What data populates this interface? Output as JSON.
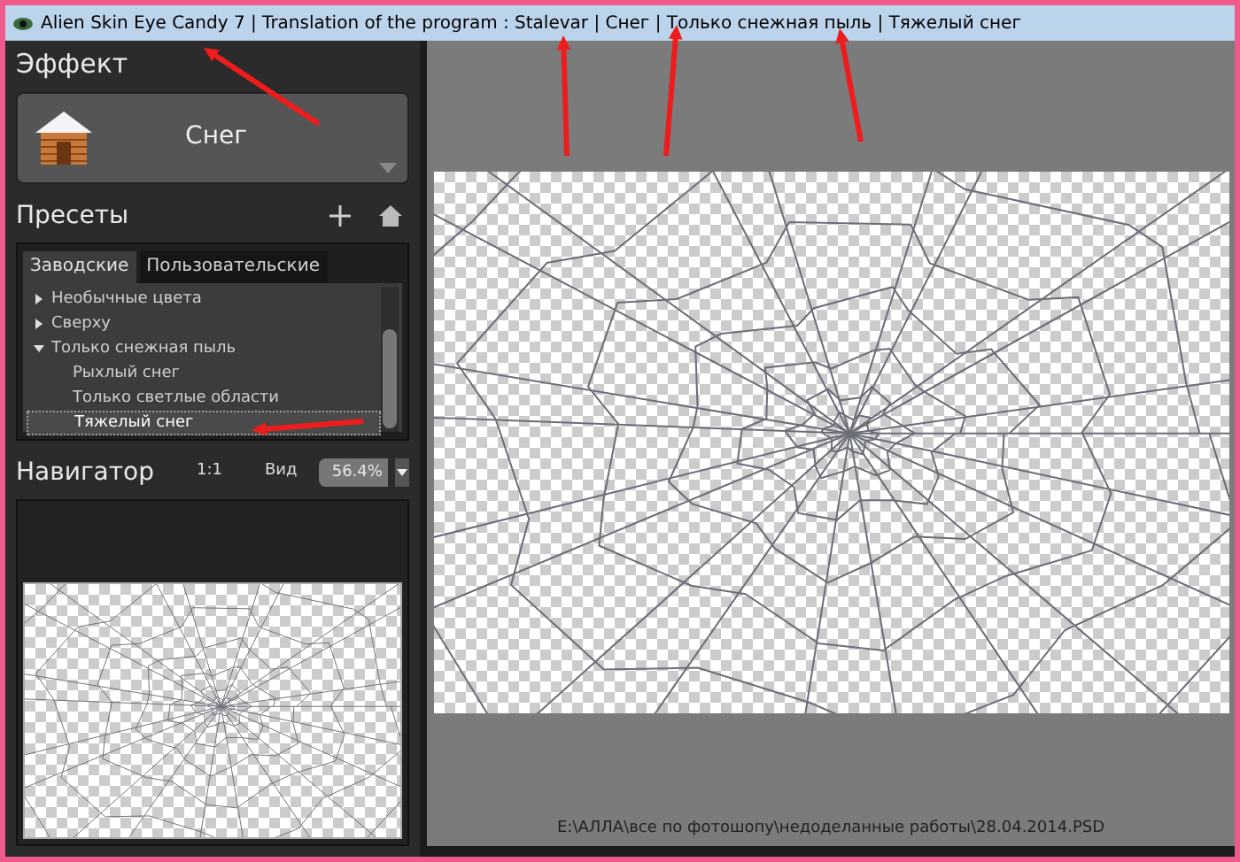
{
  "window": {
    "title": "Alien Skin Eye Candy 7 | Translation of the program : Stalevar | Снег | Только снежная пыль | Тяжелый снег"
  },
  "effect": {
    "heading": "Эффект",
    "name": "Снег"
  },
  "presets": {
    "heading": "Пресеты",
    "tabs": [
      {
        "label": "Заводские",
        "selected": true
      },
      {
        "label": "Пользовательские",
        "selected": false
      }
    ],
    "tree": [
      {
        "label": "Необычные цвета",
        "expanded": false,
        "selected": false
      },
      {
        "label": "Сверху",
        "expanded": false,
        "selected": false
      },
      {
        "label": "Только снежная пыль",
        "expanded": true,
        "selected": false,
        "children": [
          {
            "label": "Рыхлый снег",
            "selected": false
          },
          {
            "label": "Только светлые области",
            "selected": false
          },
          {
            "label": "Тяжелый снег",
            "selected": true
          }
        ]
      }
    ]
  },
  "navigator": {
    "heading": "Навигатор",
    "ratio": "1:1",
    "view_label": "Вид",
    "zoom": "56.4%"
  },
  "status_bar": {
    "path": "E:\\АЛЛА\\все по фотошопу\\недоделанные работы\\28.04.2014.PSD"
  }
}
